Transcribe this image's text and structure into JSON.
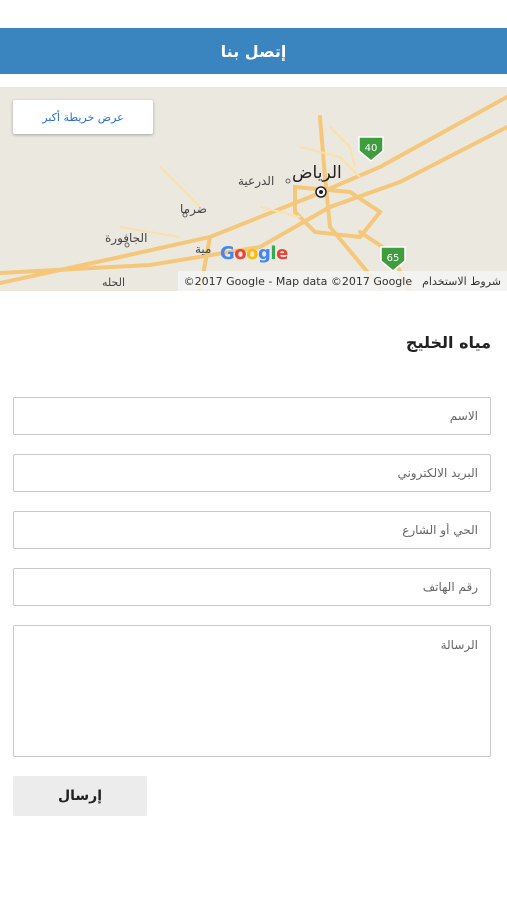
{
  "header": {
    "title": "إتصل بنا"
  },
  "map": {
    "larger_map_label": "عرض خريطة أكبر",
    "labels": {
      "riyadh": "الرياض",
      "diriyah": "الدرعية",
      "dirma": "ضرما",
      "jafura": "الجافورة",
      "muzahmiya": "مية",
      "hilla": "الحله"
    },
    "road_shields": [
      "40",
      "65"
    ],
    "google_logo": "Google",
    "copyright": "©2017 Google - Map data ©2017 Google",
    "terms": "شروط الاستخدام"
  },
  "company": {
    "name": "مياه الخليج"
  },
  "form": {
    "name_placeholder": "الاسم",
    "email_placeholder": "البريد الالكتروني",
    "district_placeholder": "الحي أو الشارع",
    "phone_placeholder": "رقم الهاتف",
    "message_placeholder": "الرسالة",
    "submit_label": "إرسال"
  }
}
